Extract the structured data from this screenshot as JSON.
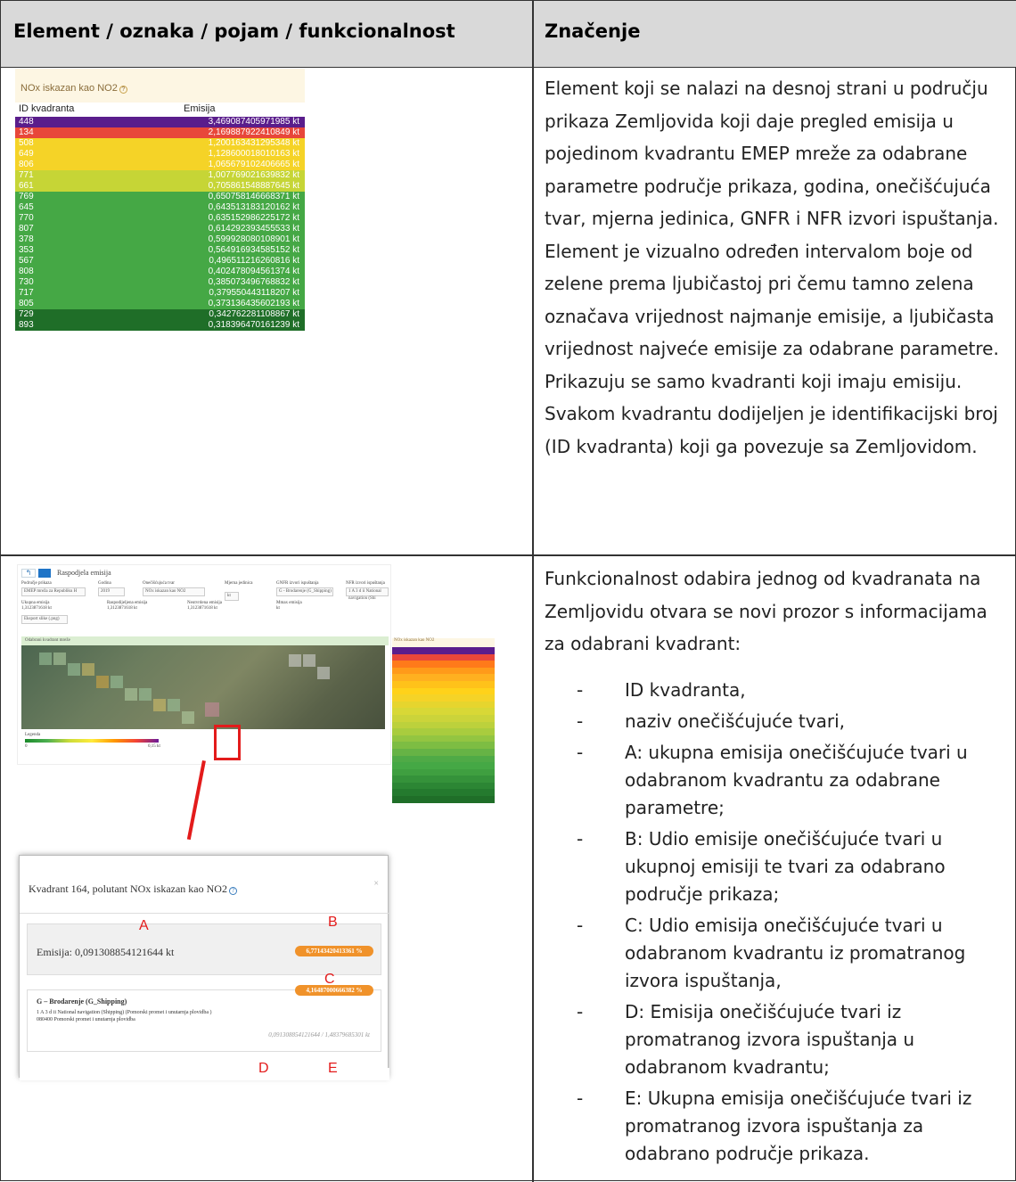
{
  "header": {
    "col1": "Element / oznaka / pojam / funkcionalnost",
    "col2": "Značenje"
  },
  "row1": {
    "description": "Element koji se nalazi na desnoj strani u području prikaza Zemljovida koji daje pregled emisija u pojedinom kvadrantu EMEP mreže za odabrane parametre područje prikaza, godina, onečišćujuća tvar, mjerna jedinica, GNFR i NFR izvori ispuštanja. Element je vizualno određen intervalom boje od zelene prema ljubičastoj pri čemu tamno zelena označava vrijednost najmanje emisije, a ljubičasta vrijednost najveće emisije za odabrane parametre. Prikazuju se samo kvadranti koji imaju emisiju. Svakom kvadrantu dodijeljen je identifikacijski broj (ID kvadranta) koji ga povezuje sa Zemljovidom.",
    "legend": {
      "caption": "NOx iskazan kao NO2",
      "col_id": "ID kvadranta",
      "col_em": "Emisija",
      "rows": [
        {
          "id": "448",
          "value": "3,469087405971985 kt",
          "color": "#5a1d8c"
        },
        {
          "id": "134",
          "value": "2,169887922410849 kt",
          "color": "#e8473a"
        },
        {
          "id": "508",
          "value": "1,200163431295348 kt",
          "color": "#f5d327"
        },
        {
          "id": "649",
          "value": "1,128600018010163 kt",
          "color": "#f5d327"
        },
        {
          "id": "806",
          "value": "1,065679102406665 kt",
          "color": "#f5d327"
        },
        {
          "id": "771",
          "value": "1,007769021639832 kt",
          "color": "#c6d536"
        },
        {
          "id": "661",
          "value": "0,705861548887645 kt",
          "color": "#c6d536"
        },
        {
          "id": "769",
          "value": "0,650758146668371 kt",
          "color": "#45a845"
        },
        {
          "id": "645",
          "value": "0,643513183120162 kt",
          "color": "#45a845"
        },
        {
          "id": "770",
          "value": "0,635152986225172 kt",
          "color": "#45a845"
        },
        {
          "id": "807",
          "value": "0,614292393455533 kt",
          "color": "#45a845"
        },
        {
          "id": "378",
          "value": "0,599928080108901 kt",
          "color": "#45a845"
        },
        {
          "id": "353",
          "value": "0,564916934585152 kt",
          "color": "#45a845"
        },
        {
          "id": "567",
          "value": "0,496511216260816 kt",
          "color": "#45a845"
        },
        {
          "id": "808",
          "value": "0,402478094561374 kt",
          "color": "#45a845"
        },
        {
          "id": "730",
          "value": "0,385073496768832 kt",
          "color": "#45a845"
        },
        {
          "id": "717",
          "value": "0,379550443118207 kt",
          "color": "#45a845"
        },
        {
          "id": "805",
          "value": "0,373136435602193 kt",
          "color": "#45a845"
        },
        {
          "id": "729",
          "value": "0,342762281108867 kt",
          "color": "#1f6e28"
        },
        {
          "id": "893",
          "value": "0,318396470161239 kt",
          "color": "#1f6e28"
        }
      ]
    }
  },
  "row2": {
    "intro": "Funkcionalnost odabira jednog od kvadranata na Zemljovidu otvara se novi prozor s informacijama za odabrani kvadrant:",
    "items": [
      "ID kvadranta,",
      "naziv onečišćujuće tvari,",
      "A: ukupna emisija onečišćujuće tvari u odabranom kvadrantu za odabrane parametre;",
      "B: Udio emisije onečišćujuće tvari u ukupnoj emisiji te tvari za odabrano područje prikaza;",
      "C: Udio emisija onečišćujuće tvari u odabranom kvadrantu iz promatranog izvora ispuštanja,",
      "D: Emisija onečišćujuće tvari iz promatranog izvora ispuštanja u odabranom kvadrantu;",
      "E: Ukupna emisija onečišćujuće tvari iz promatranog izvora ispuštanja za odabrano područje prikaza."
    ],
    "screenshot": {
      "title": "Raspodjela emisija",
      "f_area_label": "Područje prikaza",
      "f_area_value": "EMEP mreža za Republiku H",
      "f_year_label": "Godina",
      "f_year_value": "2019",
      "f_poll_label": "Onečišćujuća tvar",
      "f_poll_value": "NOx iskazan kao NO2",
      "f_unit_label": "Mjerna jedinica",
      "f_unit_value": "kt",
      "f_gnfr_label": "GNFR izvori ispuštanja",
      "f_gnfr_value": "G - Brodarenje (G_Shipping)",
      "f_nfr_label": "NFR izvori ispuštanja",
      "f_nfr_value": "1 A 3 d ii National navigation (Shi",
      "s1_label": "Ukupna emisija",
      "s1_value": "1,3123871618 kt",
      "s2_label": "Raspodijeljena emisija",
      "s2_value": "1,3123871618 kt",
      "s3_label": "Neutvrdena emisija",
      "s3_value": "1,3123871618 kt",
      "s4_label": "Mmax emisija",
      "s4_value": "kt",
      "export_btn": "Eksport slike (.png)",
      "map_label": "Odabrani kvadrant mreže",
      "side_caption": "NOx iskazan kao NO2",
      "legend_label": "Legenda",
      "legend_min": "0",
      "legend_max": "0,15 kt"
    },
    "popup": {
      "title": "Kvadrant 164, polutant NOx iskazan kao NO2",
      "close": "×",
      "emission": "Emisija: 0,091308854121644 kt",
      "pill_b": "6,77143420413361 %",
      "pill_c": "4,16487000666382 %",
      "source_title": "G – Brodarenje (G_Shipping)",
      "source_line1": "1 A 3 d ii National navigation (Shipping) (Pomorski promet i unutarnja plovidba )",
      "source_line2": "080400 Pomorski promet i unutarnja plovidba",
      "values": "0,091308854121644 / 1,48379685301 kt",
      "letter_a": "A",
      "letter_b": "B",
      "letter_c": "C",
      "letter_d": "D",
      "letter_e": "E"
    }
  }
}
